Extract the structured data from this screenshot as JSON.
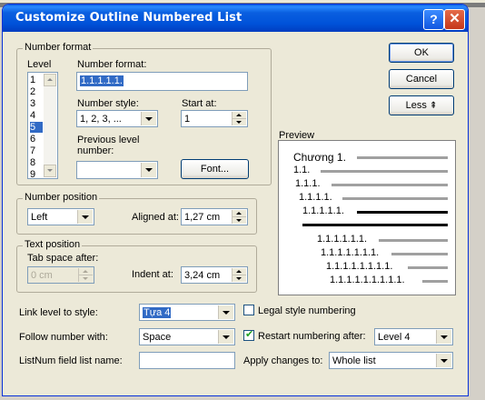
{
  "dialog": {
    "title": "Customize Outline Numbered List",
    "help_glyph": "?",
    "close_glyph": "✕"
  },
  "number_format_group": {
    "title": "Number format",
    "level_label": "Level",
    "levels": [
      "1",
      "2",
      "3",
      "4",
      "5",
      "6",
      "7",
      "8",
      "9"
    ],
    "selected_level": "5",
    "number_format_label": "Number format:",
    "number_format_value": "1.1.1.1.1.",
    "number_style_label": "Number style:",
    "number_style_value": "1, 2, 3, ...",
    "start_at_label": "Start at:",
    "start_at_value": "1",
    "previous_level_label_1": "Previous level",
    "previous_level_label_2": "number:",
    "previous_level_value": "",
    "font_button": "Font..."
  },
  "number_position_group": {
    "title": "Number position",
    "alignment_value": "Left",
    "aligned_at_label": "Aligned at:",
    "aligned_at_value": "1,27 cm"
  },
  "text_position_group": {
    "title": "Text position",
    "tab_space_label": "Tab space after:",
    "tab_space_value": "0 cm",
    "indent_at_label": "Indent at:",
    "indent_at_value": "3,24 cm"
  },
  "buttons": {
    "ok": "OK",
    "cancel": "Cancel",
    "less": "Less",
    "less_glyph": "⇞"
  },
  "preview": {
    "label": "Preview",
    "items": [
      "Chương 1.",
      "1.1.",
      "1.1.1.",
      "1.1.1.1.",
      "1.1.1.1.1.",
      "1.1.1.1.1.1.",
      "1.1.1.1.1.1.1.",
      "1.1.1.1.1.1.1.1.",
      "1.1.1.1.1.1.1.1.1."
    ]
  },
  "bottom": {
    "link_level_label": "Link level to style:",
    "link_level_value": "Tựa 4",
    "legal_style_label": "Legal style numbering",
    "legal_style_checked": false,
    "follow_number_label": "Follow number with:",
    "follow_number_value": "Space",
    "restart_label": "Restart numbering after:",
    "restart_checked": true,
    "restart_value": "Level 4",
    "listnum_label": "ListNum field list name:",
    "listnum_value": "",
    "apply_changes_label": "Apply changes to:",
    "apply_changes_value": "Whole list"
  },
  "colors": {
    "title_bar": "#0a5fe0",
    "dialog_bg": "#ece9d8",
    "selection": "#316ac5"
  }
}
